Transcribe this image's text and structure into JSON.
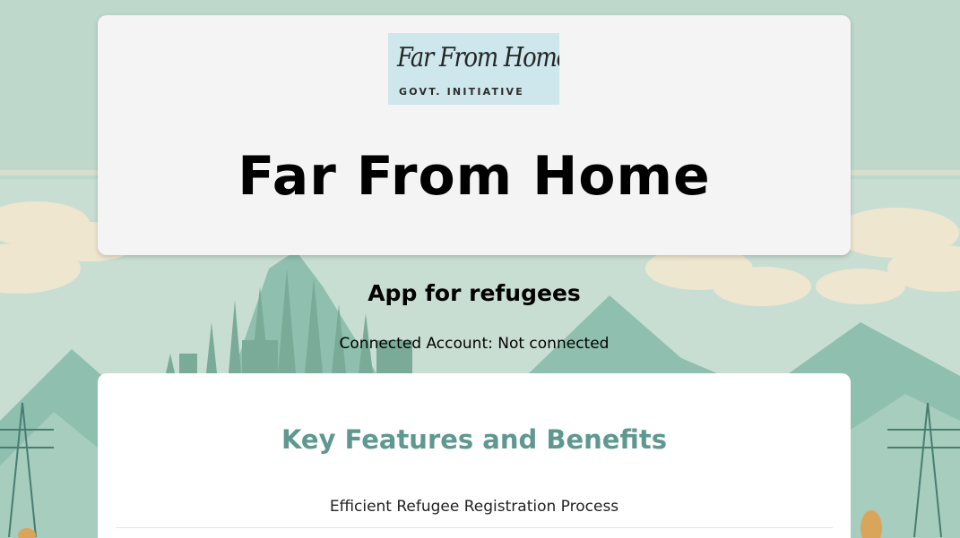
{
  "logo": {
    "script_text": "Far From Home",
    "subtitle": "GOVT. INITIATIVE"
  },
  "header": {
    "title": "Far From Home"
  },
  "tagline": "App for refugees",
  "account": {
    "status_text": "Connected Account: Not connected"
  },
  "features": {
    "title": "Key Features and Benefits",
    "items": [
      "Efficient Refugee Registration Process"
    ]
  },
  "colors": {
    "background": "#c7ddd2",
    "card": "#f4f4f4",
    "logo_bg": "#cde7ec",
    "accent": "#5f9890",
    "mountain": "#8fbfae",
    "city": "#7aaa98",
    "cloud": "#f0e7cf",
    "pylon": "#4a7d72"
  }
}
